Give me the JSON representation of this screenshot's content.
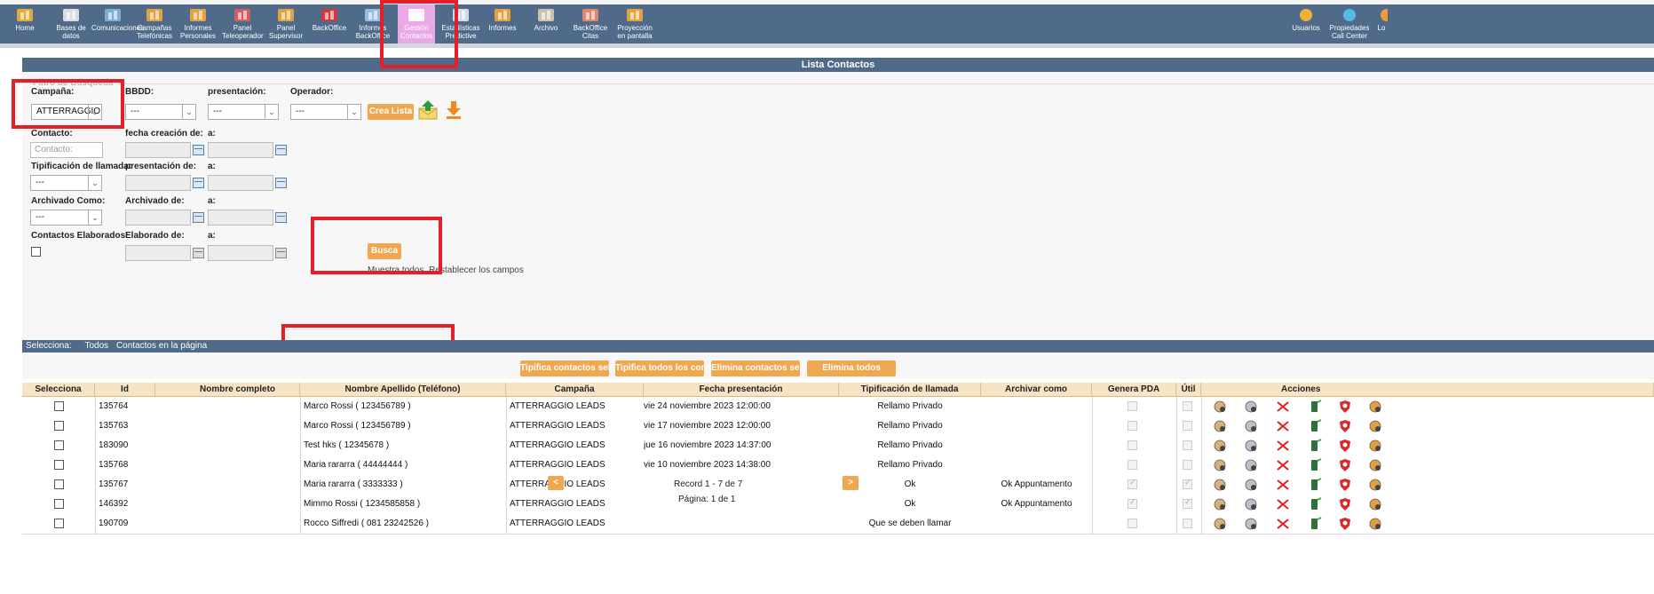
{
  "topnav": {
    "items": [
      {
        "label": "Home",
        "icon": "home-icon"
      },
      {
        "label": "Bases de datos",
        "icon": "database-icon"
      },
      {
        "label": "Comunicaciones",
        "icon": "globe-icon"
      },
      {
        "label": "Campañas Telefónicas",
        "icon": "campaign-icon"
      },
      {
        "label": "Informes Personales",
        "icon": "bar-chart-icon"
      },
      {
        "label": "Panel Teleoperador",
        "icon": "operator-icon"
      },
      {
        "label": "Panel Supervisor",
        "icon": "supervisor-icon"
      },
      {
        "label": "BackOffice",
        "icon": "binders-icon"
      },
      {
        "label": "Informes BackOffice",
        "icon": "report-icon"
      },
      {
        "label": "Gestión Contactos",
        "icon": "contacts-icon"
      },
      {
        "label": "Estadísticas Predictive",
        "icon": "stats-icon"
      },
      {
        "label": "Informes",
        "icon": "bar-chart-icon"
      },
      {
        "label": "Archivo",
        "icon": "cabinet-icon"
      },
      {
        "label": "BackOffice Citas",
        "icon": "notebook-icon"
      },
      {
        "label": "Proyección en pantalla",
        "icon": "projection-icon"
      }
    ],
    "right_items": [
      {
        "label": "Usuarios",
        "icon": "users-icon"
      },
      {
        "label": "Propiedades Call Center",
        "icon": "gears-icon"
      },
      {
        "label": "Lo",
        "icon": "logout-icon"
      }
    ]
  },
  "panel": {
    "title": "Lista Contactos",
    "legend": "Filtro de Búsqueda"
  },
  "filters": {
    "campana_label": "Campaña:",
    "campana_value": "ATTERRAGGIO",
    "bbdd_label": "BBDD:",
    "bbdd_value": "---",
    "presentacion_label": "presentación:",
    "presentacion_value": "---",
    "operador_label": "Operador:",
    "operador_value": "---",
    "crea_lista": "Crea Lista",
    "contacto_label": "Contacto:",
    "contacto_placeholder": "Contacto:",
    "fecha_creacion_label": "fecha creación de:",
    "a_label": "a:",
    "tipificacion_label": "Tipificación de llamada:",
    "tipificacion_value": "---",
    "presentacion_de_label": "presentación de:",
    "archivado_como_label": "Archivado Como:",
    "archivado_como_value": "---",
    "archivado_de_label": "Archivado de:",
    "contactos_elaborados_label": "Contactos Elaborados:",
    "elaborado_de_label": "Elaborado de:",
    "busca": "Busca",
    "muestra_todos": "Muestra todos",
    "restablecer": "Restablecer los campos"
  },
  "selbar": {
    "label": "Selecciona:",
    "todos": "Todos",
    "pagina": "Contactos en la página"
  },
  "bulk_actions": {
    "tipifica_sel": "Tipifica contactos selec",
    "tipifica_todos": "Tipifica todos los contac",
    "elimina_sel": "Elimina contactos selec",
    "elimina_todos": "Elimina todos"
  },
  "table": {
    "headers": [
      "Selecciona",
      "Id",
      "Nombre completo",
      "Nombre Apellido (Teléfono)",
      "Campaña",
      "Fecha presentación",
      "Tipificación de llamada",
      "Archivar como",
      "Genera PDA",
      "Útil",
      "Acciones"
    ],
    "rows": [
      {
        "id": "135764",
        "name": "Marco Rossi ( 123456789 )",
        "campaign": "ATTERRAGGIO LEADS",
        "fecha": "vie 24 noviembre 2023 12:00:00",
        "tip": "Rellamo Privado",
        "archivar": "",
        "pda": false,
        "util": false
      },
      {
        "id": "135763",
        "name": "Marco Rossi ( 123456789 )",
        "campaign": "ATTERRAGGIO LEADS",
        "fecha": "vie 17 noviembre 2023 12:00:00",
        "tip": "Rellamo Privado",
        "archivar": "",
        "pda": false,
        "util": false
      },
      {
        "id": "183090",
        "name": "Test hks ( 12345678 )",
        "campaign": "ATTERRAGGIO LEADS",
        "fecha": "jue 16 noviembre 2023 14:37:00",
        "tip": "Rellamo Privado",
        "archivar": "",
        "pda": false,
        "util": false
      },
      {
        "id": "135768",
        "name": "Maria rararra ( 44444444 )",
        "campaign": "ATTERRAGGIO LEADS",
        "fecha": "vie 10 noviembre 2023 14:38:00",
        "tip": "Rellamo Privado",
        "archivar": "",
        "pda": false,
        "util": false
      },
      {
        "id": "135767",
        "name": "Maria rararra ( 3333333 )",
        "campaign": "ATTERRAGGIO LEADS",
        "fecha": "",
        "tip": "Ok",
        "archivar": "Ok Appuntamento",
        "pda": true,
        "util": true
      },
      {
        "id": "146392",
        "name": "Mimmo Rossi ( 1234585858 )",
        "campaign": "ATTERRAGGIO LEADS",
        "fecha": "",
        "tip": "Ok",
        "archivar": "Ok Appuntamento",
        "pda": true,
        "util": true
      },
      {
        "id": "190709",
        "name": "Rocco Siffredi ( 081 23242526 )",
        "campaign": "ATTERRAGGIO LEADS",
        "fecha": "",
        "tip": "Que se deben llamar",
        "archivar": "",
        "pda": false,
        "util": false
      }
    ]
  },
  "pager": {
    "prev": "<",
    "next": ">",
    "record": "Record 1 - 7 de 7",
    "pagina": "Página: 1 de 1"
  },
  "colors": {
    "navbar": "#4f6b89",
    "active_tab": "#e9a9e4",
    "button": "#f0a850",
    "highlight": "#e3202a"
  }
}
